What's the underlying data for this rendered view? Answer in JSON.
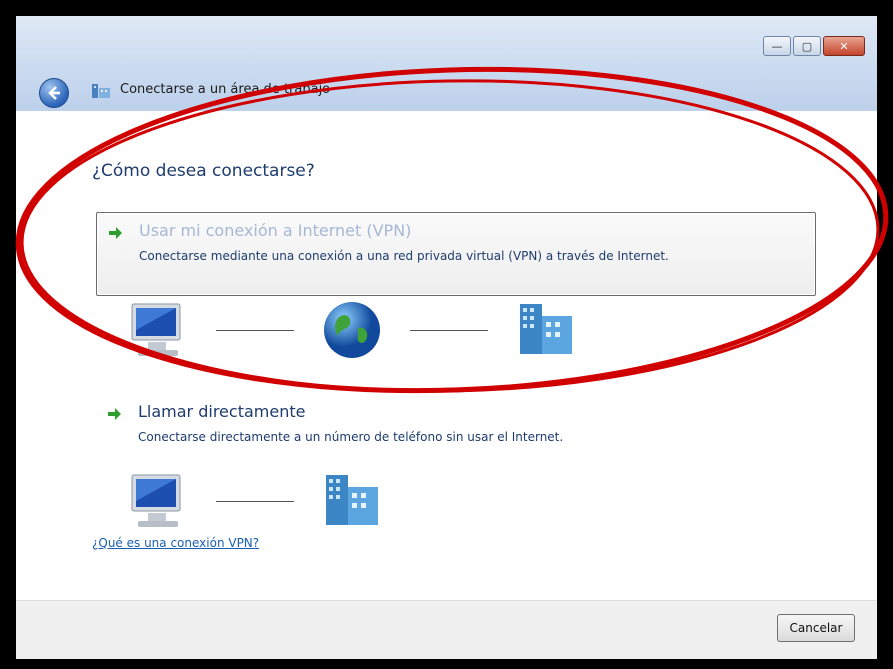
{
  "window": {
    "title": "Conectarse a un área de trabajo",
    "controls": {
      "minimize": "—",
      "maximize": "▢",
      "close": "✕"
    }
  },
  "main": {
    "heading": "¿Cómo desea conectarse?",
    "options": [
      {
        "title": "Usar mi conexión a Internet (VPN)",
        "description": "Conectarse mediante una conexión a una red privada virtual (VPN) a través de Internet.",
        "selected": true
      },
      {
        "title": "Llamar directamente",
        "description": "Conectarse directamente a un número de teléfono sin usar el Internet.",
        "selected": false
      }
    ],
    "help_link": "¿Qué es una conexión VPN?"
  },
  "footer": {
    "cancel_label": "Cancelar"
  },
  "colors": {
    "annotation_red": "#d10000",
    "heading_blue": "#1e3c6e",
    "link_blue": "#1a5fb4",
    "arrow_green": "#2e9e2e"
  },
  "icons": [
    "back-arrow-icon",
    "network-app-icon",
    "green-arrow-icon",
    "computer-icon",
    "globe-icon",
    "building-icon"
  ]
}
